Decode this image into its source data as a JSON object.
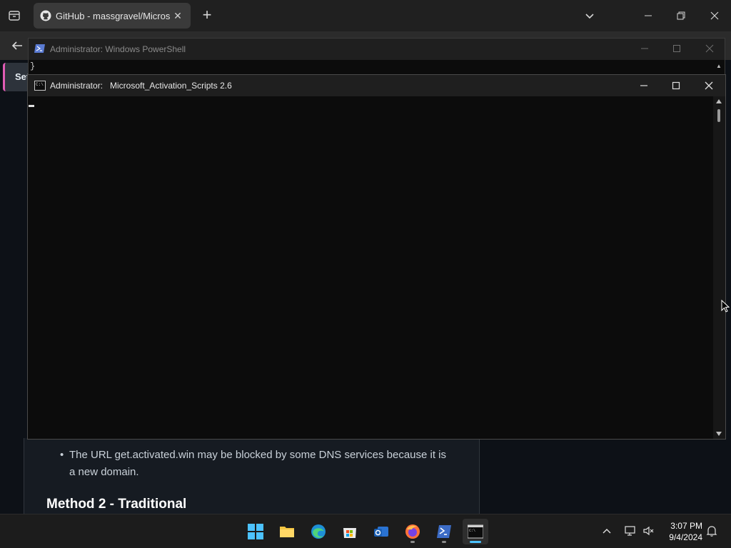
{
  "browser": {
    "tab_title": "GitHub - massgravel/Microsoft-Activation-Scripts",
    "new_tab_label": "+",
    "tab_close_label": "✕"
  },
  "sidebar": {
    "card_label": "Set"
  },
  "powershell": {
    "title": "Administrator: Windows PowerShell",
    "line": "}"
  },
  "console": {
    "title": "Administrator:   Microsoft_Activation_Scripts 2.6"
  },
  "page": {
    "bullet_text": "The URL get.activated.win may be blocked by some DNS services because it is a new domain.",
    "heading": "Method 2 - Traditional"
  },
  "taskbar": {
    "apps": [
      "start-icon",
      "file-explorer-icon",
      "edge-icon",
      "store-icon",
      "outlook-icon",
      "firefox-icon",
      "powershell-icon",
      "terminal-icon"
    ],
    "time": "3:07 PM",
    "date": "9/4/2024"
  },
  "colors": {
    "accent": "#4cc2ff",
    "console_bg": "#0c0c0c",
    "page_bg": "#0d1117"
  }
}
